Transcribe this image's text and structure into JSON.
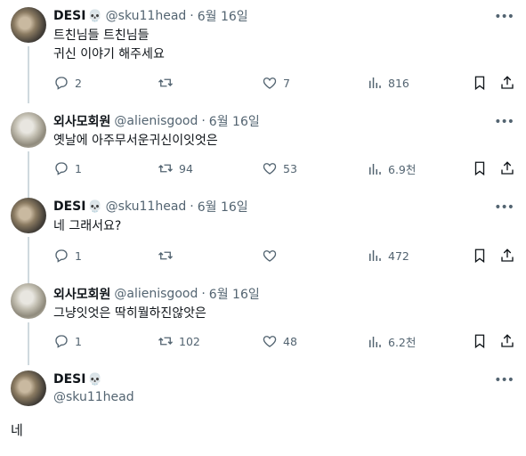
{
  "tweets": [
    {
      "name": "DESI",
      "emoji": "💀",
      "handle": "@sku11head",
      "time": "6월 16일",
      "text_lines": [
        "트친님들 트친님들",
        "귀신 이야기 해주세요"
      ],
      "reply_count": "2",
      "retweet_count": "",
      "like_count": "7",
      "view_count": "816"
    },
    {
      "name": "외사모회원",
      "handle": "@alienisgood",
      "time": "6월 16일",
      "text_lines": [
        "옛날에 아주무서운귀신이잇엇은"
      ],
      "reply_count": "1",
      "retweet_count": "94",
      "like_count": "53",
      "view_count": "6.9천"
    },
    {
      "name": "DESI",
      "emoji": "💀",
      "handle": "@sku11head",
      "time": "6월 16일",
      "text_lines": [
        "네 그래서요?"
      ],
      "reply_count": "1",
      "retweet_count": "",
      "like_count": "",
      "view_count": "472"
    },
    {
      "name": "외사모회원",
      "handle": "@alienisgood",
      "time": "6월 16일",
      "text_lines": [
        "그냥잇엇은 딱히뭘하진않앗은"
      ],
      "reply_count": "1",
      "retweet_count": "102",
      "like_count": "48",
      "view_count": "6.2천"
    }
  ],
  "main_tweet": {
    "name": "DESI",
    "emoji": "💀",
    "handle": "@sku11head",
    "text": "네"
  },
  "separator": "·",
  "more_label": "•••",
  "icons": [
    "more-icon",
    "reply-icon",
    "retweet-icon",
    "like-icon",
    "views-icon",
    "bookmark-icon",
    "share-icon",
    "skull-emoji"
  ]
}
